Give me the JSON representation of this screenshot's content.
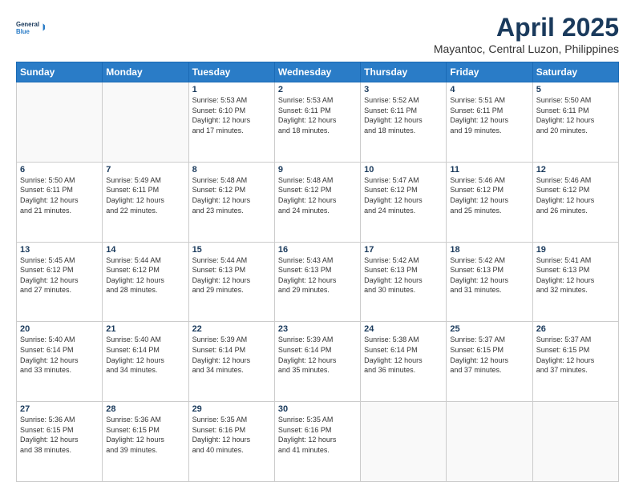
{
  "logo": {
    "line1": "General",
    "line2": "Blue"
  },
  "title": "April 2025",
  "subtitle": "Mayantoc, Central Luzon, Philippines",
  "weekdays": [
    "Sunday",
    "Monday",
    "Tuesday",
    "Wednesday",
    "Thursday",
    "Friday",
    "Saturday"
  ],
  "weeks": [
    [
      {
        "day": "",
        "info": ""
      },
      {
        "day": "",
        "info": ""
      },
      {
        "day": "1",
        "info": "Sunrise: 5:53 AM\nSunset: 6:10 PM\nDaylight: 12 hours\nand 17 minutes."
      },
      {
        "day": "2",
        "info": "Sunrise: 5:53 AM\nSunset: 6:11 PM\nDaylight: 12 hours\nand 18 minutes."
      },
      {
        "day": "3",
        "info": "Sunrise: 5:52 AM\nSunset: 6:11 PM\nDaylight: 12 hours\nand 18 minutes."
      },
      {
        "day": "4",
        "info": "Sunrise: 5:51 AM\nSunset: 6:11 PM\nDaylight: 12 hours\nand 19 minutes."
      },
      {
        "day": "5",
        "info": "Sunrise: 5:50 AM\nSunset: 6:11 PM\nDaylight: 12 hours\nand 20 minutes."
      }
    ],
    [
      {
        "day": "6",
        "info": "Sunrise: 5:50 AM\nSunset: 6:11 PM\nDaylight: 12 hours\nand 21 minutes."
      },
      {
        "day": "7",
        "info": "Sunrise: 5:49 AM\nSunset: 6:11 PM\nDaylight: 12 hours\nand 22 minutes."
      },
      {
        "day": "8",
        "info": "Sunrise: 5:48 AM\nSunset: 6:12 PM\nDaylight: 12 hours\nand 23 minutes."
      },
      {
        "day": "9",
        "info": "Sunrise: 5:48 AM\nSunset: 6:12 PM\nDaylight: 12 hours\nand 24 minutes."
      },
      {
        "day": "10",
        "info": "Sunrise: 5:47 AM\nSunset: 6:12 PM\nDaylight: 12 hours\nand 24 minutes."
      },
      {
        "day": "11",
        "info": "Sunrise: 5:46 AM\nSunset: 6:12 PM\nDaylight: 12 hours\nand 25 minutes."
      },
      {
        "day": "12",
        "info": "Sunrise: 5:46 AM\nSunset: 6:12 PM\nDaylight: 12 hours\nand 26 minutes."
      }
    ],
    [
      {
        "day": "13",
        "info": "Sunrise: 5:45 AM\nSunset: 6:12 PM\nDaylight: 12 hours\nand 27 minutes."
      },
      {
        "day": "14",
        "info": "Sunrise: 5:44 AM\nSunset: 6:12 PM\nDaylight: 12 hours\nand 28 minutes."
      },
      {
        "day": "15",
        "info": "Sunrise: 5:44 AM\nSunset: 6:13 PM\nDaylight: 12 hours\nand 29 minutes."
      },
      {
        "day": "16",
        "info": "Sunrise: 5:43 AM\nSunset: 6:13 PM\nDaylight: 12 hours\nand 29 minutes."
      },
      {
        "day": "17",
        "info": "Sunrise: 5:42 AM\nSunset: 6:13 PM\nDaylight: 12 hours\nand 30 minutes."
      },
      {
        "day": "18",
        "info": "Sunrise: 5:42 AM\nSunset: 6:13 PM\nDaylight: 12 hours\nand 31 minutes."
      },
      {
        "day": "19",
        "info": "Sunrise: 5:41 AM\nSunset: 6:13 PM\nDaylight: 12 hours\nand 32 minutes."
      }
    ],
    [
      {
        "day": "20",
        "info": "Sunrise: 5:40 AM\nSunset: 6:14 PM\nDaylight: 12 hours\nand 33 minutes."
      },
      {
        "day": "21",
        "info": "Sunrise: 5:40 AM\nSunset: 6:14 PM\nDaylight: 12 hours\nand 34 minutes."
      },
      {
        "day": "22",
        "info": "Sunrise: 5:39 AM\nSunset: 6:14 PM\nDaylight: 12 hours\nand 34 minutes."
      },
      {
        "day": "23",
        "info": "Sunrise: 5:39 AM\nSunset: 6:14 PM\nDaylight: 12 hours\nand 35 minutes."
      },
      {
        "day": "24",
        "info": "Sunrise: 5:38 AM\nSunset: 6:14 PM\nDaylight: 12 hours\nand 36 minutes."
      },
      {
        "day": "25",
        "info": "Sunrise: 5:37 AM\nSunset: 6:15 PM\nDaylight: 12 hours\nand 37 minutes."
      },
      {
        "day": "26",
        "info": "Sunrise: 5:37 AM\nSunset: 6:15 PM\nDaylight: 12 hours\nand 37 minutes."
      }
    ],
    [
      {
        "day": "27",
        "info": "Sunrise: 5:36 AM\nSunset: 6:15 PM\nDaylight: 12 hours\nand 38 minutes."
      },
      {
        "day": "28",
        "info": "Sunrise: 5:36 AM\nSunset: 6:15 PM\nDaylight: 12 hours\nand 39 minutes."
      },
      {
        "day": "29",
        "info": "Sunrise: 5:35 AM\nSunset: 6:16 PM\nDaylight: 12 hours\nand 40 minutes."
      },
      {
        "day": "30",
        "info": "Sunrise: 5:35 AM\nSunset: 6:16 PM\nDaylight: 12 hours\nand 41 minutes."
      },
      {
        "day": "",
        "info": ""
      },
      {
        "day": "",
        "info": ""
      },
      {
        "day": "",
        "info": ""
      }
    ]
  ]
}
